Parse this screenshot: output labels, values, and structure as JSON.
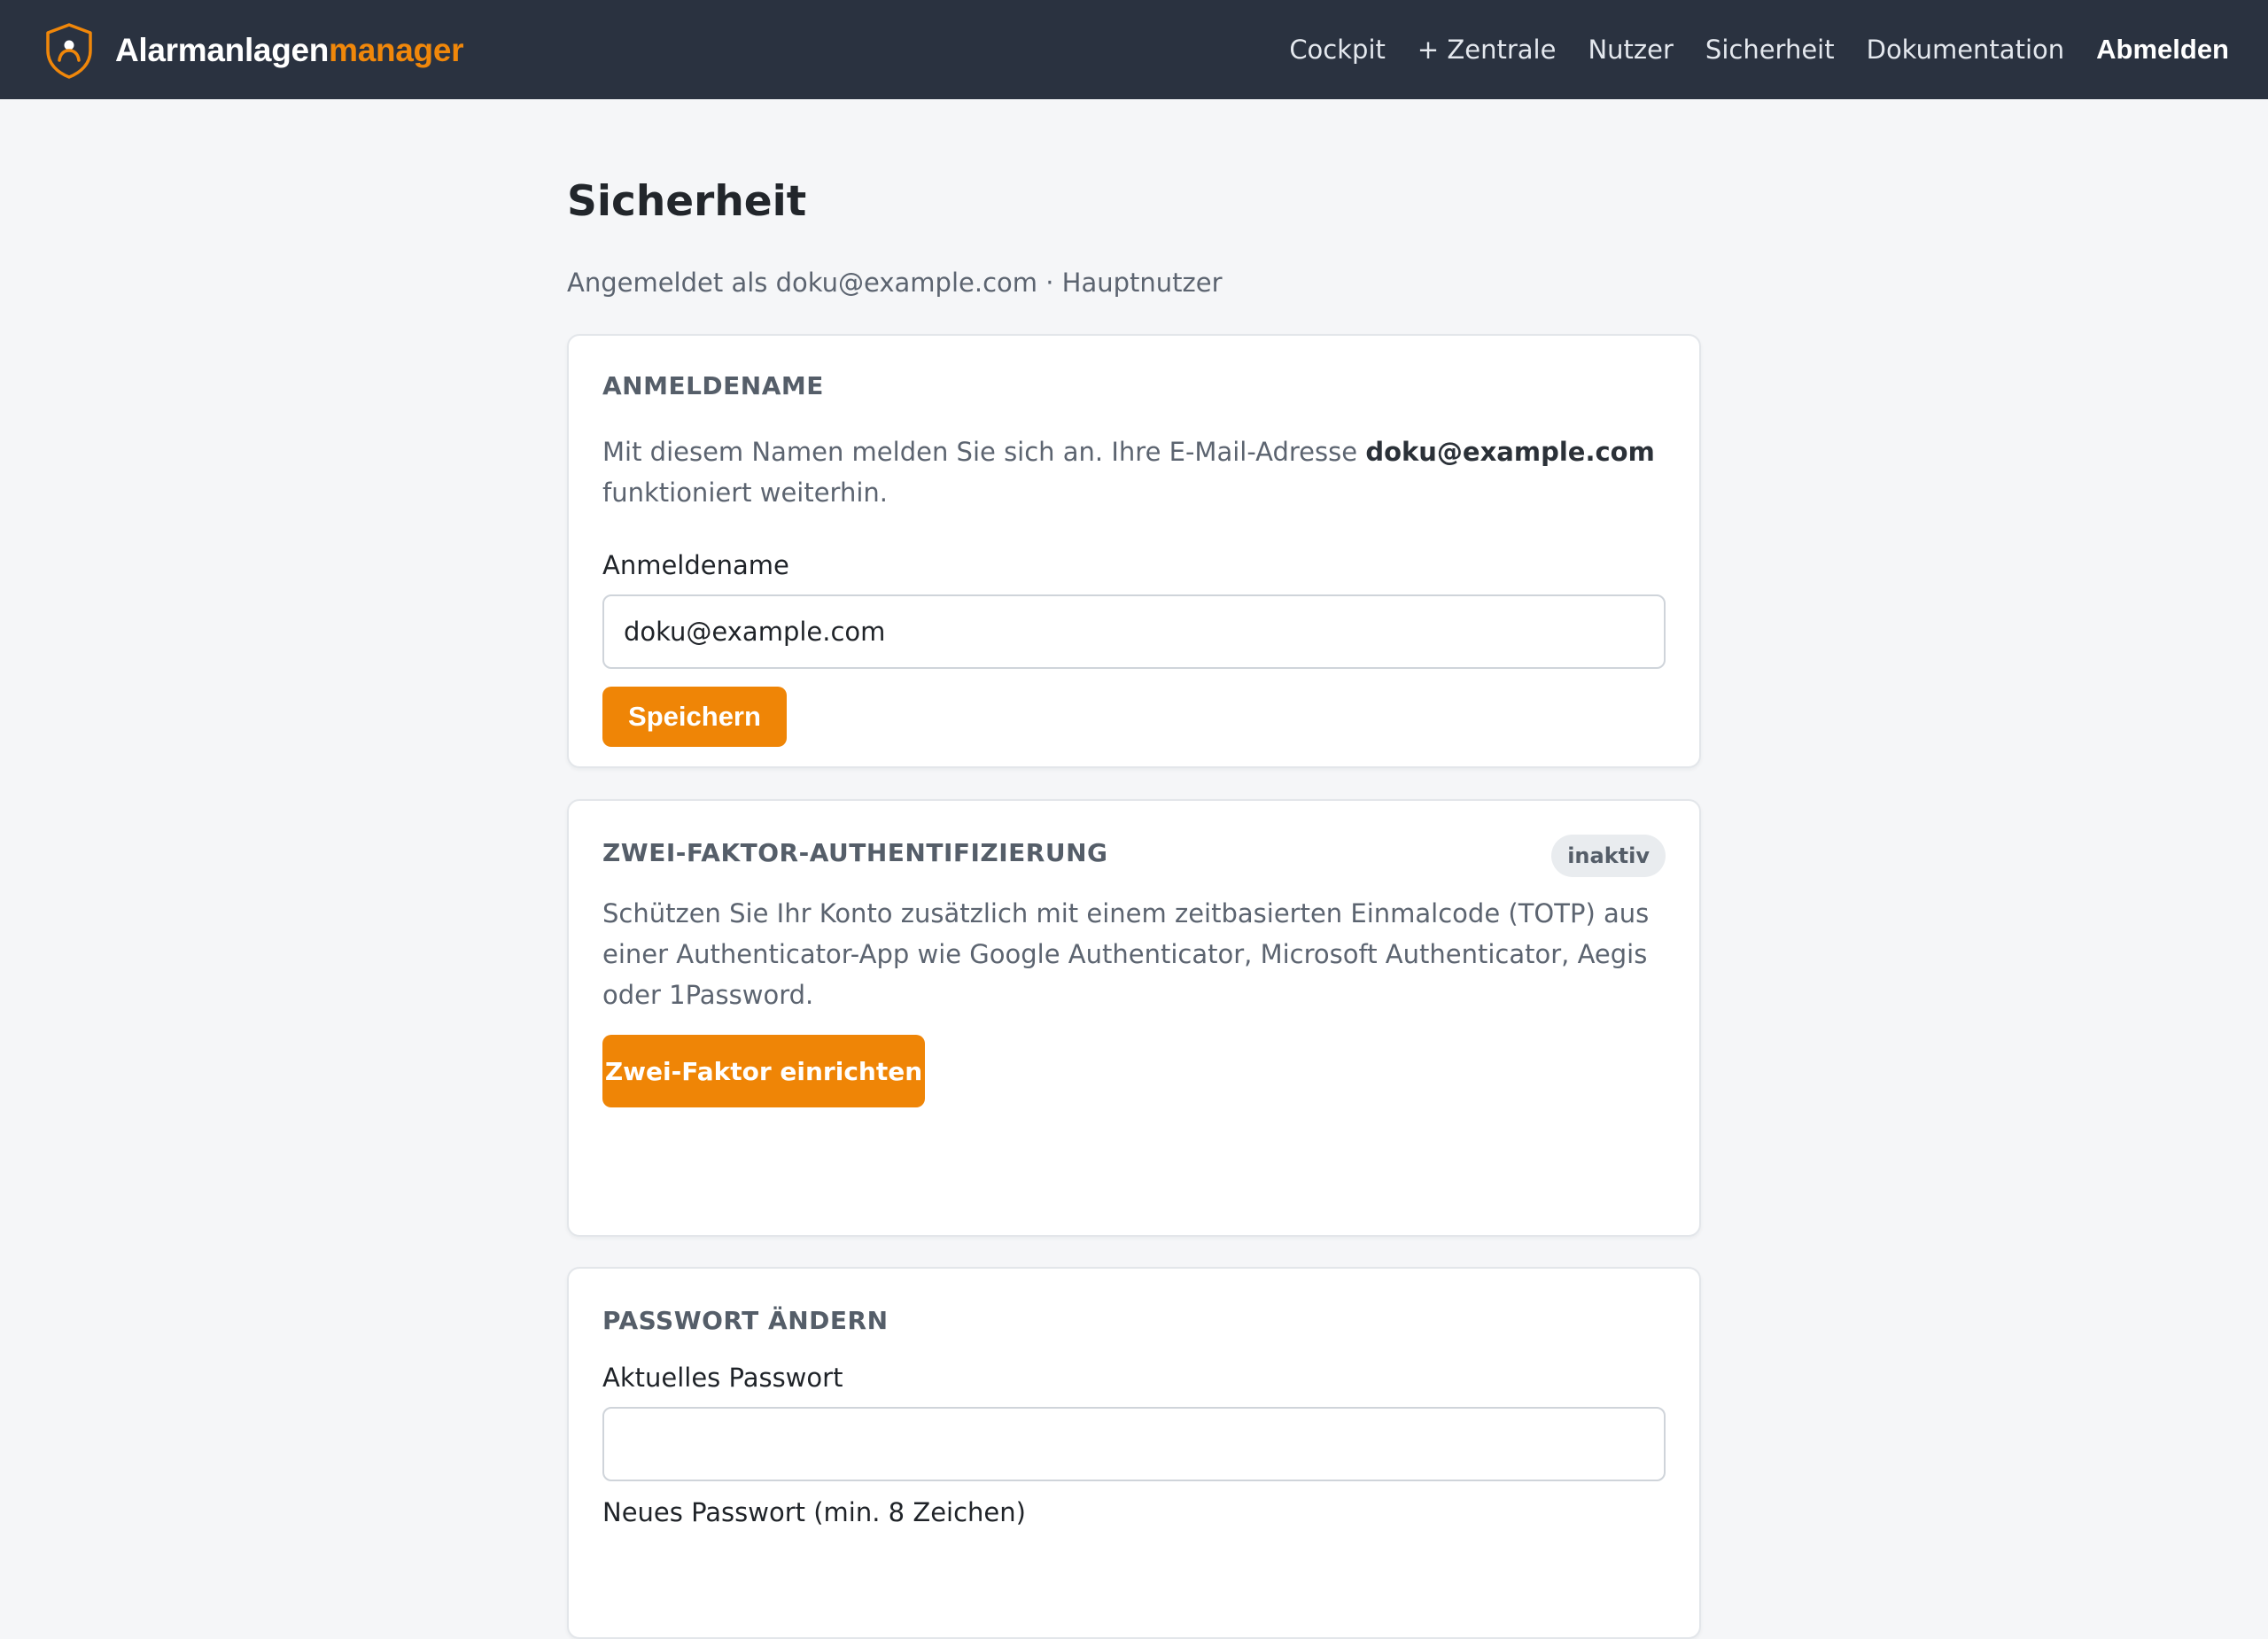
{
  "brand": {
    "name_primary": "Alarmanlagen",
    "name_accent": "manager",
    "logo_icon": "shield-user-icon",
    "accent_color": "#f0870a"
  },
  "nav": {
    "items": [
      {
        "label": "Cockpit"
      },
      {
        "label": "+ Zentrale"
      },
      {
        "label": "Nutzer"
      },
      {
        "label": "Sicherheit"
      },
      {
        "label": "Dokumentation"
      }
    ],
    "logout_label": "Abmelden"
  },
  "page": {
    "title": "Sicherheit",
    "subtitle": "Angemeldet als doku@example.com · Hauptnutzer"
  },
  "username_card": {
    "title": "ANMELDENAME",
    "text_before": "Mit diesem Namen melden Sie sich an. Ihre E-Mail-Adresse ",
    "email": "doku@example.com",
    "text_after": " funktioniert weiterhin.",
    "field_label": "Anmeldename",
    "field_value": "doku@example.com",
    "save_label": "Speichern"
  },
  "twofa_card": {
    "title": "ZWEI-FAKTOR-AUTHENTIFIZIERUNG",
    "status_badge": "inaktiv",
    "description": "Schützen Sie Ihr Konto zusätzlich mit einem zeitbasierten Einmalcode (TOTP) aus einer Authenticator-App wie Google Authenticator, Microsoft Authenticator, Aegis oder 1Password.",
    "setup_label": "Zwei-Faktor einrichten"
  },
  "password_card": {
    "title": "PASSWORT ÄNDERN",
    "current_label": "Aktuelles Passwort",
    "current_value": "",
    "new_label": "Neues Passwort (min. 8 Zeichen)"
  },
  "colors": {
    "topbar_bg": "#2a3240",
    "primary_button": "#ef8506",
    "page_bg": "#f5f6f8"
  }
}
